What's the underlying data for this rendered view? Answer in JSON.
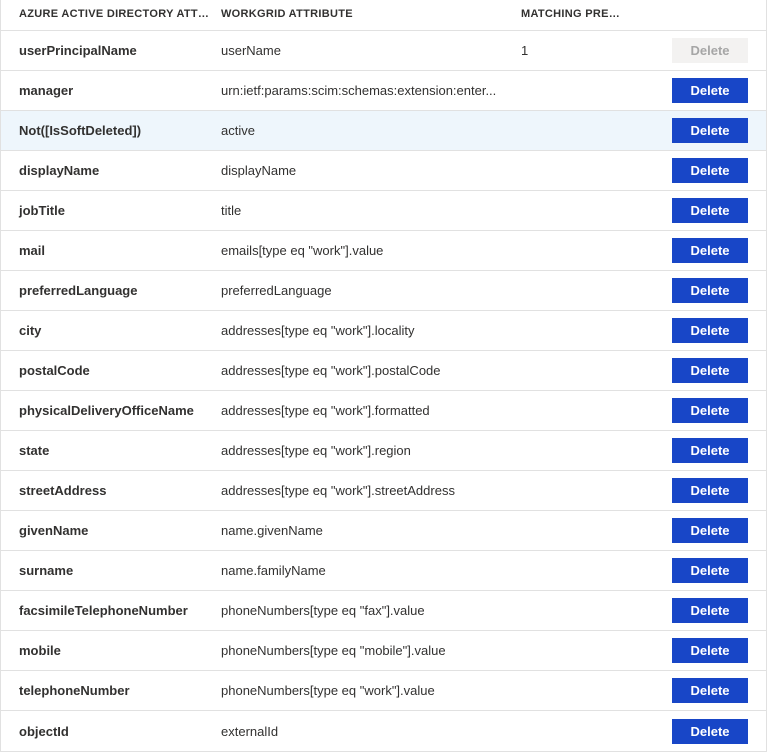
{
  "headers": {
    "azure": "AZURE ACTIVE DIRECTORY ATTRIBU...",
    "workgrid": "WORKGRID ATTRIBUTE",
    "matching": "MATCHING PREC..."
  },
  "deleteLabel": "Delete",
  "rows": [
    {
      "azure": "userPrincipalName",
      "workgrid": "userName",
      "matching": "1",
      "disabled": true,
      "highlighted": false
    },
    {
      "azure": "manager",
      "workgrid": "urn:ietf:params:scim:schemas:extension:enter...",
      "matching": "",
      "disabled": false,
      "highlighted": false
    },
    {
      "azure": "Not([IsSoftDeleted])",
      "workgrid": "active",
      "matching": "",
      "disabled": false,
      "highlighted": true
    },
    {
      "azure": "displayName",
      "workgrid": "displayName",
      "matching": "",
      "disabled": false,
      "highlighted": false
    },
    {
      "azure": "jobTitle",
      "workgrid": "title",
      "matching": "",
      "disabled": false,
      "highlighted": false
    },
    {
      "azure": "mail",
      "workgrid": "emails[type eq \"work\"].value",
      "matching": "",
      "disabled": false,
      "highlighted": false
    },
    {
      "azure": "preferredLanguage",
      "workgrid": "preferredLanguage",
      "matching": "",
      "disabled": false,
      "highlighted": false
    },
    {
      "azure": "city",
      "workgrid": "addresses[type eq \"work\"].locality",
      "matching": "",
      "disabled": false,
      "highlighted": false
    },
    {
      "azure": "postalCode",
      "workgrid": "addresses[type eq \"work\"].postalCode",
      "matching": "",
      "disabled": false,
      "highlighted": false
    },
    {
      "azure": "physicalDeliveryOfficeName",
      "workgrid": "addresses[type eq \"work\"].formatted",
      "matching": "",
      "disabled": false,
      "highlighted": false
    },
    {
      "azure": "state",
      "workgrid": "addresses[type eq \"work\"].region",
      "matching": "",
      "disabled": false,
      "highlighted": false
    },
    {
      "azure": "streetAddress",
      "workgrid": "addresses[type eq \"work\"].streetAddress",
      "matching": "",
      "disabled": false,
      "highlighted": false
    },
    {
      "azure": "givenName",
      "workgrid": "name.givenName",
      "matching": "",
      "disabled": false,
      "highlighted": false
    },
    {
      "azure": "surname",
      "workgrid": "name.familyName",
      "matching": "",
      "disabled": false,
      "highlighted": false
    },
    {
      "azure": "facsimileTelephoneNumber",
      "workgrid": "phoneNumbers[type eq \"fax\"].value",
      "matching": "",
      "disabled": false,
      "highlighted": false
    },
    {
      "azure": "mobile",
      "workgrid": "phoneNumbers[type eq \"mobile\"].value",
      "matching": "",
      "disabled": false,
      "highlighted": false
    },
    {
      "azure": "telephoneNumber",
      "workgrid": "phoneNumbers[type eq \"work\"].value",
      "matching": "",
      "disabled": false,
      "highlighted": false
    },
    {
      "azure": "objectId",
      "workgrid": "externalId",
      "matching": "",
      "disabled": false,
      "highlighted": false
    }
  ]
}
